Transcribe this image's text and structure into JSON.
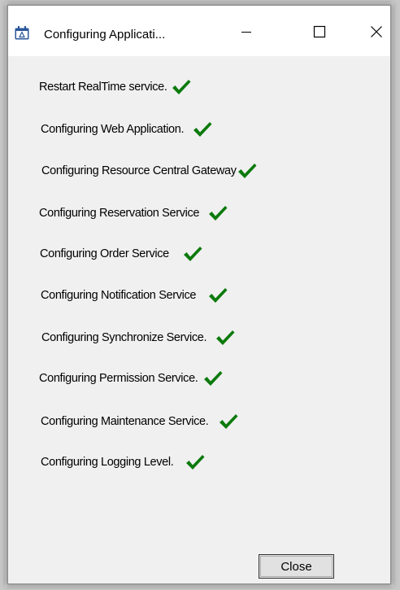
{
  "window": {
    "title": "Configuring Applicati...",
    "icon": "calendar-icon",
    "controls": [
      "minimize-icon",
      "maximize-icon",
      "close-icon"
    ]
  },
  "steps": [
    {
      "label": "Restart RealTime service.",
      "status": "done"
    },
    {
      "label": "Configuring Web Application.",
      "status": "done"
    },
    {
      "label": "Configuring Resource Central Gateway",
      "status": "done"
    },
    {
      "label": "Configuring Reservation Service",
      "status": "done"
    },
    {
      "label": "Configuring Order Service",
      "status": "done"
    },
    {
      "label": "Configuring Notification Service",
      "status": "done"
    },
    {
      "label": "Configuring Synchronize Service.",
      "status": "done"
    },
    {
      "label": "Configuring Permission Service.",
      "status": "done"
    },
    {
      "label": "Configuring Maintenance Service.",
      "status": "done"
    },
    {
      "label": "Configuring Logging Level.",
      "status": "done"
    }
  ],
  "footer": {
    "close_label": "Close"
  },
  "colors": {
    "check": "#0b7a0b",
    "window_bg": "#f0f0f0",
    "titlebar_bg": "#ffffff",
    "icon_blue": "#2b579a"
  }
}
